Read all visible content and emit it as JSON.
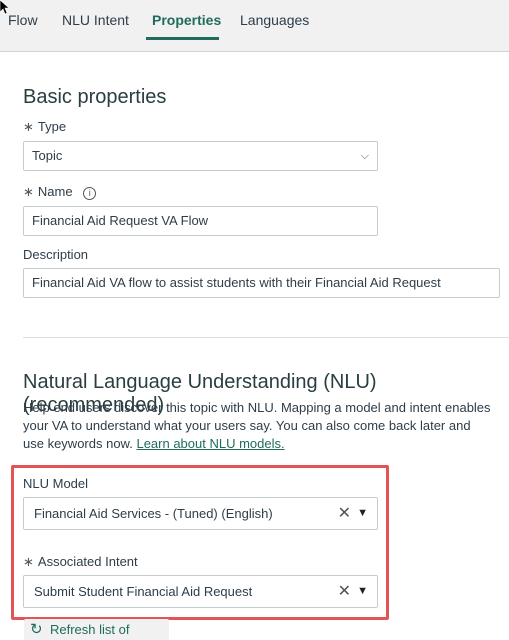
{
  "tabs": {
    "flow": "Flow",
    "nlu_intent": "NLU Intent",
    "properties": "Properties",
    "languages": "Languages"
  },
  "basic": {
    "heading": "Basic properties",
    "type_label": "Type",
    "type_value": "Topic",
    "name_label": "Name",
    "name_value": "Financial Aid Request VA Flow",
    "description_label": "Description",
    "description_value": "Financial Aid VA flow to assist students with their Financial Aid Request"
  },
  "nlu": {
    "heading": "Natural Language Understanding (NLU) (recommended)",
    "help_text": "Help end users discover this topic with NLU. Mapping a model and intent enables your VA to understand what your users say. You can also come back later and use keywords now.",
    "learn_link": "Learn about NLU models.",
    "model_label": "NLU Model",
    "model_value": "Financial Aid Services - (Tuned) (English)",
    "intent_label": "Associated Intent",
    "intent_value": "Submit Student Financial Aid Request",
    "refresh_label": "Refresh list of intents"
  },
  "icons": {
    "required": "asterisk-icon",
    "info": "info-icon",
    "chevron": "chevron-down-icon",
    "clear": "clear-x-icon",
    "caret": "caret-down-icon",
    "refresh": "refresh-icon"
  },
  "colors": {
    "accent": "#1f6b5c",
    "highlight": "#e45454"
  }
}
